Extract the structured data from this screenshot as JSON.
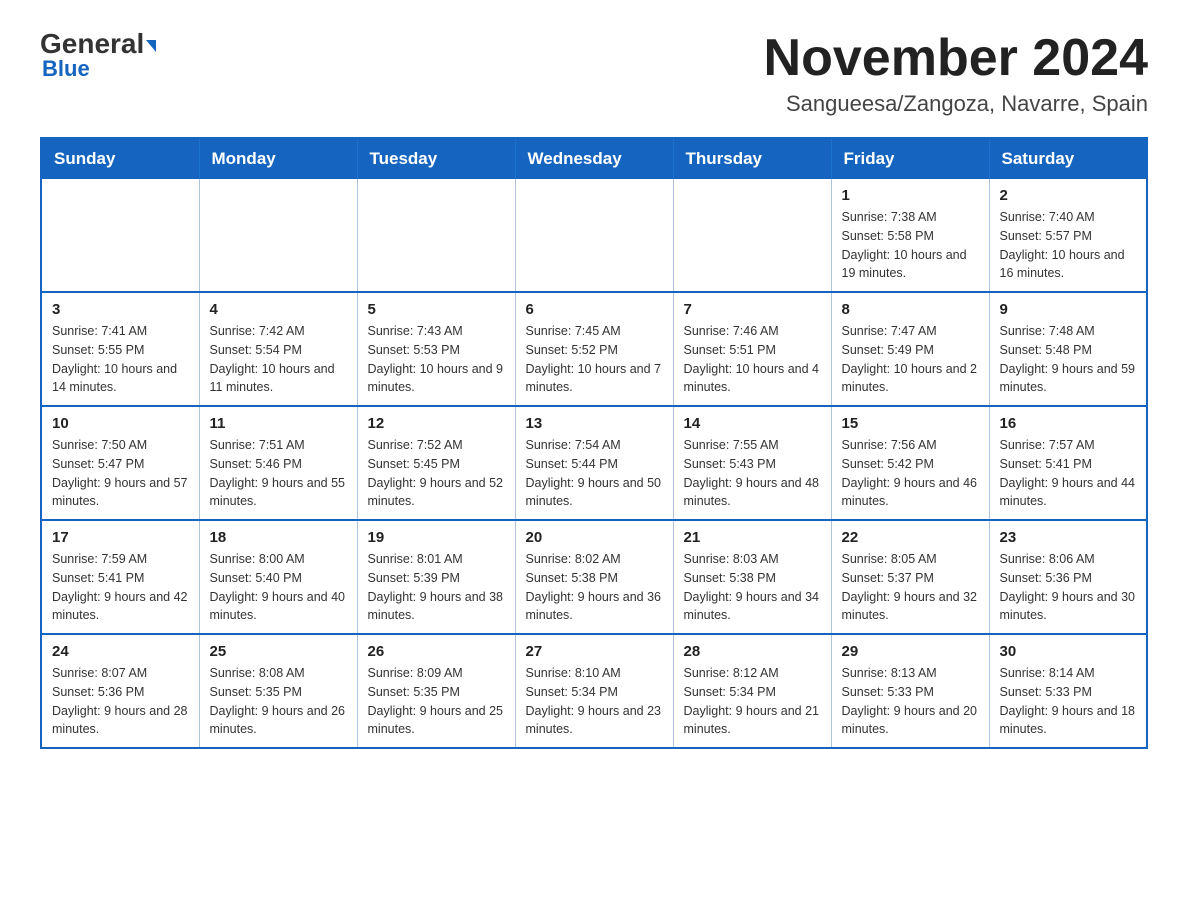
{
  "logo": {
    "general": "General",
    "blue": "Blue"
  },
  "title": {
    "month_year": "November 2024",
    "location": "Sangueesa/Zangoza, Navarre, Spain"
  },
  "headers": [
    "Sunday",
    "Monday",
    "Tuesday",
    "Wednesday",
    "Thursday",
    "Friday",
    "Saturday"
  ],
  "weeks": [
    [
      {
        "day": "",
        "sunrise": "",
        "sunset": "",
        "daylight": ""
      },
      {
        "day": "",
        "sunrise": "",
        "sunset": "",
        "daylight": ""
      },
      {
        "day": "",
        "sunrise": "",
        "sunset": "",
        "daylight": ""
      },
      {
        "day": "",
        "sunrise": "",
        "sunset": "",
        "daylight": ""
      },
      {
        "day": "",
        "sunrise": "",
        "sunset": "",
        "daylight": ""
      },
      {
        "day": "1",
        "sunrise": "Sunrise: 7:38 AM",
        "sunset": "Sunset: 5:58 PM",
        "daylight": "Daylight: 10 hours and 19 minutes."
      },
      {
        "day": "2",
        "sunrise": "Sunrise: 7:40 AM",
        "sunset": "Sunset: 5:57 PM",
        "daylight": "Daylight: 10 hours and 16 minutes."
      }
    ],
    [
      {
        "day": "3",
        "sunrise": "Sunrise: 7:41 AM",
        "sunset": "Sunset: 5:55 PM",
        "daylight": "Daylight: 10 hours and 14 minutes."
      },
      {
        "day": "4",
        "sunrise": "Sunrise: 7:42 AM",
        "sunset": "Sunset: 5:54 PM",
        "daylight": "Daylight: 10 hours and 11 minutes."
      },
      {
        "day": "5",
        "sunrise": "Sunrise: 7:43 AM",
        "sunset": "Sunset: 5:53 PM",
        "daylight": "Daylight: 10 hours and 9 minutes."
      },
      {
        "day": "6",
        "sunrise": "Sunrise: 7:45 AM",
        "sunset": "Sunset: 5:52 PM",
        "daylight": "Daylight: 10 hours and 7 minutes."
      },
      {
        "day": "7",
        "sunrise": "Sunrise: 7:46 AM",
        "sunset": "Sunset: 5:51 PM",
        "daylight": "Daylight: 10 hours and 4 minutes."
      },
      {
        "day": "8",
        "sunrise": "Sunrise: 7:47 AM",
        "sunset": "Sunset: 5:49 PM",
        "daylight": "Daylight: 10 hours and 2 minutes."
      },
      {
        "day": "9",
        "sunrise": "Sunrise: 7:48 AM",
        "sunset": "Sunset: 5:48 PM",
        "daylight": "Daylight: 9 hours and 59 minutes."
      }
    ],
    [
      {
        "day": "10",
        "sunrise": "Sunrise: 7:50 AM",
        "sunset": "Sunset: 5:47 PM",
        "daylight": "Daylight: 9 hours and 57 minutes."
      },
      {
        "day": "11",
        "sunrise": "Sunrise: 7:51 AM",
        "sunset": "Sunset: 5:46 PM",
        "daylight": "Daylight: 9 hours and 55 minutes."
      },
      {
        "day": "12",
        "sunrise": "Sunrise: 7:52 AM",
        "sunset": "Sunset: 5:45 PM",
        "daylight": "Daylight: 9 hours and 52 minutes."
      },
      {
        "day": "13",
        "sunrise": "Sunrise: 7:54 AM",
        "sunset": "Sunset: 5:44 PM",
        "daylight": "Daylight: 9 hours and 50 minutes."
      },
      {
        "day": "14",
        "sunrise": "Sunrise: 7:55 AM",
        "sunset": "Sunset: 5:43 PM",
        "daylight": "Daylight: 9 hours and 48 minutes."
      },
      {
        "day": "15",
        "sunrise": "Sunrise: 7:56 AM",
        "sunset": "Sunset: 5:42 PM",
        "daylight": "Daylight: 9 hours and 46 minutes."
      },
      {
        "day": "16",
        "sunrise": "Sunrise: 7:57 AM",
        "sunset": "Sunset: 5:41 PM",
        "daylight": "Daylight: 9 hours and 44 minutes."
      }
    ],
    [
      {
        "day": "17",
        "sunrise": "Sunrise: 7:59 AM",
        "sunset": "Sunset: 5:41 PM",
        "daylight": "Daylight: 9 hours and 42 minutes."
      },
      {
        "day": "18",
        "sunrise": "Sunrise: 8:00 AM",
        "sunset": "Sunset: 5:40 PM",
        "daylight": "Daylight: 9 hours and 40 minutes."
      },
      {
        "day": "19",
        "sunrise": "Sunrise: 8:01 AM",
        "sunset": "Sunset: 5:39 PM",
        "daylight": "Daylight: 9 hours and 38 minutes."
      },
      {
        "day": "20",
        "sunrise": "Sunrise: 8:02 AM",
        "sunset": "Sunset: 5:38 PM",
        "daylight": "Daylight: 9 hours and 36 minutes."
      },
      {
        "day": "21",
        "sunrise": "Sunrise: 8:03 AM",
        "sunset": "Sunset: 5:38 PM",
        "daylight": "Daylight: 9 hours and 34 minutes."
      },
      {
        "day": "22",
        "sunrise": "Sunrise: 8:05 AM",
        "sunset": "Sunset: 5:37 PM",
        "daylight": "Daylight: 9 hours and 32 minutes."
      },
      {
        "day": "23",
        "sunrise": "Sunrise: 8:06 AM",
        "sunset": "Sunset: 5:36 PM",
        "daylight": "Daylight: 9 hours and 30 minutes."
      }
    ],
    [
      {
        "day": "24",
        "sunrise": "Sunrise: 8:07 AM",
        "sunset": "Sunset: 5:36 PM",
        "daylight": "Daylight: 9 hours and 28 minutes."
      },
      {
        "day": "25",
        "sunrise": "Sunrise: 8:08 AM",
        "sunset": "Sunset: 5:35 PM",
        "daylight": "Daylight: 9 hours and 26 minutes."
      },
      {
        "day": "26",
        "sunrise": "Sunrise: 8:09 AM",
        "sunset": "Sunset: 5:35 PM",
        "daylight": "Daylight: 9 hours and 25 minutes."
      },
      {
        "day": "27",
        "sunrise": "Sunrise: 8:10 AM",
        "sunset": "Sunset: 5:34 PM",
        "daylight": "Daylight: 9 hours and 23 minutes."
      },
      {
        "day": "28",
        "sunrise": "Sunrise: 8:12 AM",
        "sunset": "Sunset: 5:34 PM",
        "daylight": "Daylight: 9 hours and 21 minutes."
      },
      {
        "day": "29",
        "sunrise": "Sunrise: 8:13 AM",
        "sunset": "Sunset: 5:33 PM",
        "daylight": "Daylight: 9 hours and 20 minutes."
      },
      {
        "day": "30",
        "sunrise": "Sunrise: 8:14 AM",
        "sunset": "Sunset: 5:33 PM",
        "daylight": "Daylight: 9 hours and 18 minutes."
      }
    ]
  ]
}
